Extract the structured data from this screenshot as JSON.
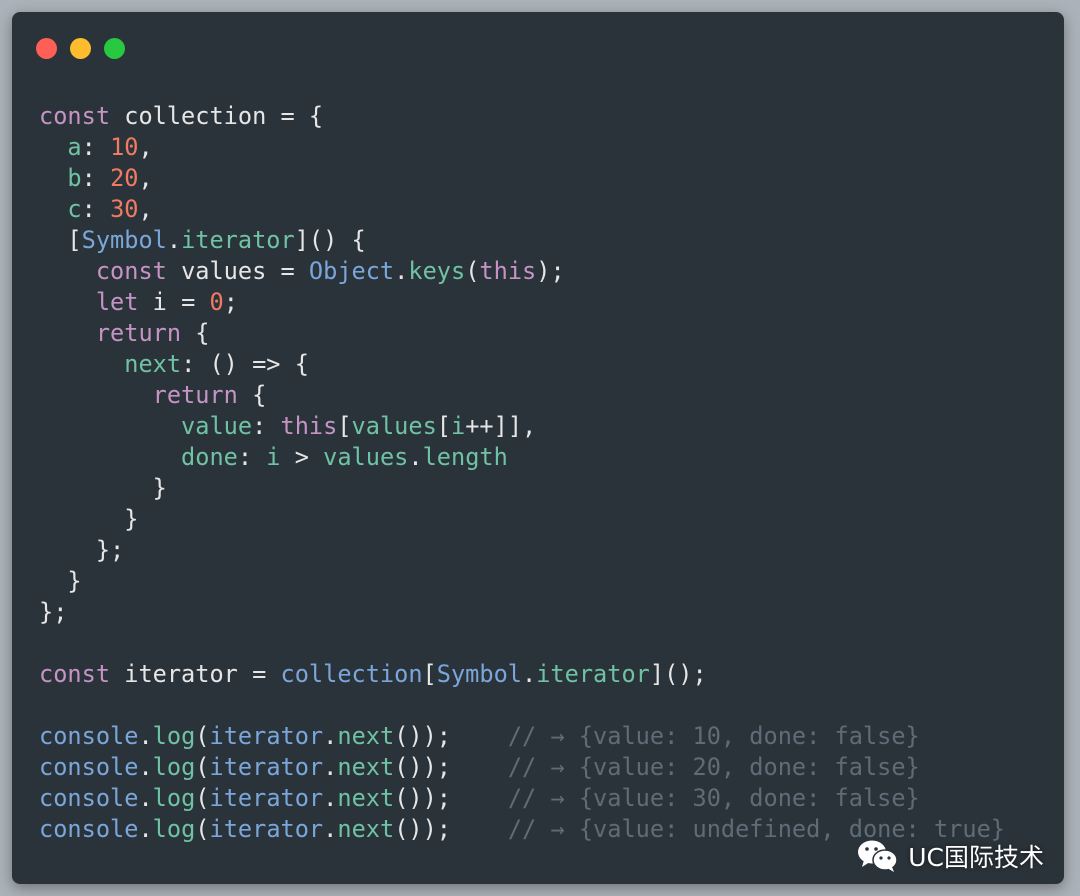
{
  "colors": {
    "keyword": "#c594c5",
    "number": "#f07a63",
    "property": "#6fc2a3",
    "builtin": "#7aa6da",
    "plain": "#e6e6e6",
    "comment": "#5f6b76",
    "background": "#2b333a"
  },
  "window_controls": [
    "close",
    "minimize",
    "maximize"
  ],
  "code_lines": [
    [
      [
        "kw",
        "const"
      ],
      [
        "pl",
        " collection = {"
      ]
    ],
    [
      [
        "pl",
        "  "
      ],
      [
        "prop",
        "a"
      ],
      [
        "pl",
        ": "
      ],
      [
        "num",
        "10"
      ],
      [
        "pl",
        ","
      ]
    ],
    [
      [
        "pl",
        "  "
      ],
      [
        "prop",
        "b"
      ],
      [
        "pl",
        ": "
      ],
      [
        "num",
        "20"
      ],
      [
        "pl",
        ","
      ]
    ],
    [
      [
        "pl",
        "  "
      ],
      [
        "prop",
        "c"
      ],
      [
        "pl",
        ": "
      ],
      [
        "num",
        "30"
      ],
      [
        "pl",
        ","
      ]
    ],
    [
      [
        "pl",
        "  ["
      ],
      [
        "bi",
        "Symbol"
      ],
      [
        "pl",
        "."
      ],
      [
        "fn",
        "iterator"
      ],
      [
        "pl",
        "]() {"
      ]
    ],
    [
      [
        "pl",
        "    "
      ],
      [
        "kw",
        "const"
      ],
      [
        "pl",
        " values = "
      ],
      [
        "bi",
        "Object"
      ],
      [
        "pl",
        "."
      ],
      [
        "fn",
        "keys"
      ],
      [
        "pl",
        "("
      ],
      [
        "kw",
        "this"
      ],
      [
        "pl",
        ");"
      ]
    ],
    [
      [
        "pl",
        "    "
      ],
      [
        "kw",
        "let"
      ],
      [
        "pl",
        " i = "
      ],
      [
        "num",
        "0"
      ],
      [
        "pl",
        ";"
      ]
    ],
    [
      [
        "pl",
        "    "
      ],
      [
        "kw",
        "return"
      ],
      [
        "pl",
        " {"
      ]
    ],
    [
      [
        "pl",
        "      "
      ],
      [
        "prop",
        "next"
      ],
      [
        "pl",
        ": () => {"
      ]
    ],
    [
      [
        "pl",
        "        "
      ],
      [
        "kw",
        "return"
      ],
      [
        "pl",
        " {"
      ]
    ],
    [
      [
        "pl",
        "          "
      ],
      [
        "prop",
        "value"
      ],
      [
        "pl",
        ": "
      ],
      [
        "kw",
        "this"
      ],
      [
        "pl",
        "["
      ],
      [
        "prop",
        "values"
      ],
      [
        "pl",
        "["
      ],
      [
        "prop",
        "i"
      ],
      [
        "pl",
        "++]],"
      ]
    ],
    [
      [
        "pl",
        "          "
      ],
      [
        "prop",
        "done"
      ],
      [
        "pl",
        ": "
      ],
      [
        "prop",
        "i"
      ],
      [
        "pl",
        " > "
      ],
      [
        "prop",
        "values"
      ],
      [
        "pl",
        "."
      ],
      [
        "prop",
        "length"
      ]
    ],
    [
      [
        "pl",
        "        }"
      ]
    ],
    [
      [
        "pl",
        "      }"
      ]
    ],
    [
      [
        "pl",
        "    };"
      ]
    ],
    [
      [
        "pl",
        "  }"
      ]
    ],
    [
      [
        "pl",
        "};"
      ]
    ],
    [],
    [
      [
        "kw",
        "const"
      ],
      [
        "pl",
        " iterator = "
      ],
      [
        "bi",
        "collection"
      ],
      [
        "pl",
        "["
      ],
      [
        "bi",
        "Symbol"
      ],
      [
        "pl",
        "."
      ],
      [
        "fn",
        "iterator"
      ],
      [
        "pl",
        "]();"
      ]
    ],
    [],
    [
      [
        "bi",
        "console"
      ],
      [
        "pl",
        "."
      ],
      [
        "fn",
        "log"
      ],
      [
        "pl",
        "("
      ],
      [
        "bi",
        "iterator"
      ],
      [
        "pl",
        "."
      ],
      [
        "fn",
        "next"
      ],
      [
        "pl",
        "());    "
      ],
      [
        "cm",
        "// → {value: 10, done: false}"
      ]
    ],
    [
      [
        "bi",
        "console"
      ],
      [
        "pl",
        "."
      ],
      [
        "fn",
        "log"
      ],
      [
        "pl",
        "("
      ],
      [
        "bi",
        "iterator"
      ],
      [
        "pl",
        "."
      ],
      [
        "fn",
        "next"
      ],
      [
        "pl",
        "());    "
      ],
      [
        "cm",
        "// → {value: 20, done: false}"
      ]
    ],
    [
      [
        "bi",
        "console"
      ],
      [
        "pl",
        "."
      ],
      [
        "fn",
        "log"
      ],
      [
        "pl",
        "("
      ],
      [
        "bi",
        "iterator"
      ],
      [
        "pl",
        "."
      ],
      [
        "fn",
        "next"
      ],
      [
        "pl",
        "());    "
      ],
      [
        "cm",
        "// → {value: 30, done: false}"
      ]
    ],
    [
      [
        "bi",
        "console"
      ],
      [
        "pl",
        "."
      ],
      [
        "fn",
        "log"
      ],
      [
        "pl",
        "("
      ],
      [
        "bi",
        "iterator"
      ],
      [
        "pl",
        "."
      ],
      [
        "fn",
        "next"
      ],
      [
        "pl",
        "());    "
      ],
      [
        "cm",
        "// → {value: undefined, done: true}"
      ]
    ]
  ],
  "watermark": {
    "icon": "wechat-icon",
    "text": "UC国际技术"
  }
}
